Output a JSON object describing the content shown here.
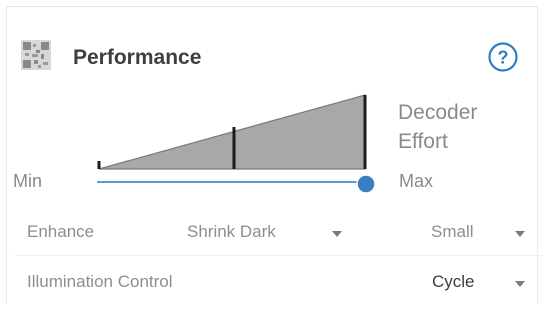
{
  "panel": {
    "title": "Performance",
    "icons": {
      "panel_icon": "qr-code-icon",
      "help": "help-circle-icon"
    }
  },
  "effort": {
    "label_line1": "Decoder",
    "label_line2": "Effort",
    "min_label": "Min",
    "max_label": "Max",
    "value_fraction": 1.0
  },
  "options": {
    "enhance": {
      "label": "Enhance",
      "mode_value": "Shrink Dark",
      "size_value": "Small"
    },
    "illumination": {
      "label": "Illumination Control",
      "value": "Cycle"
    }
  },
  "colors": {
    "accent": "#3a7fc0",
    "slider_track": "#5b9bd5",
    "triangle_fill": "#a8a8a8",
    "help": "#2f7dc3"
  }
}
